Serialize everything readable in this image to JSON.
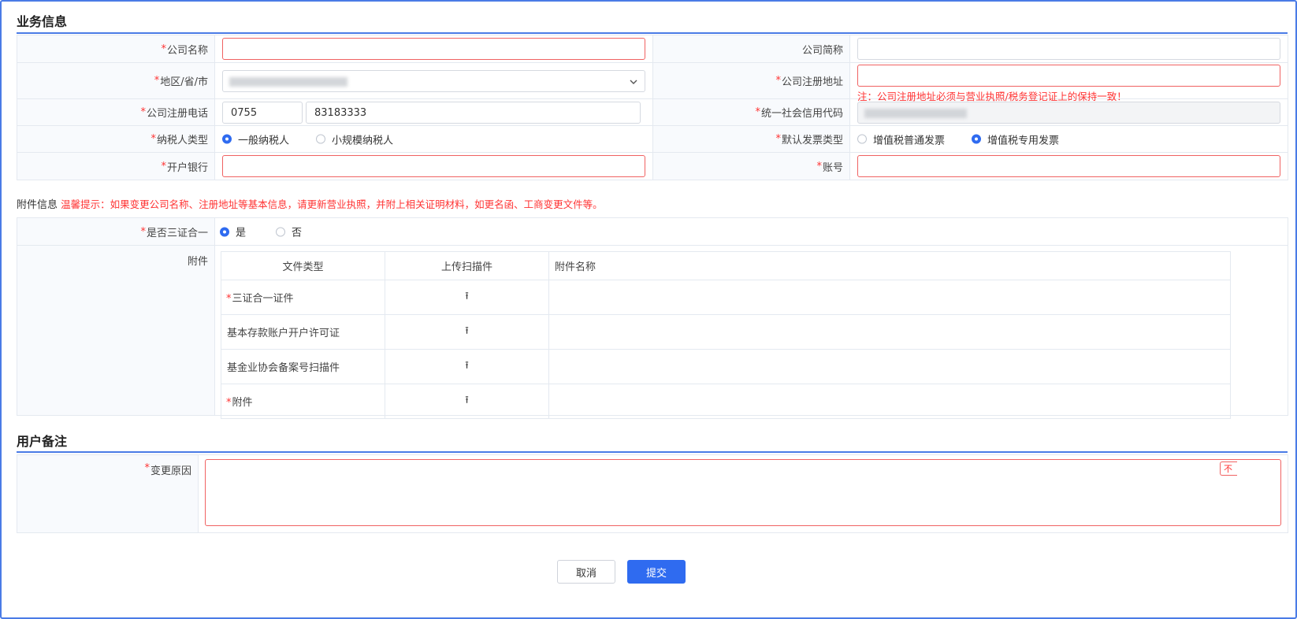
{
  "business": {
    "title": "业务信息",
    "company_name_label": "公司名称",
    "company_short_label": "公司简称",
    "region_label": "地区/省/市",
    "reg_address_label": "公司注册地址",
    "reg_address_note": "注：公司注册地址必须与营业执照/税务登记证上的保持一致！",
    "reg_phone_label": "公司注册电话",
    "phone_area": "0755",
    "phone_number": "83183333",
    "credit_code_label": "统一社会信用代码",
    "taxpayer_label": "纳税人类型",
    "taxpayer_options": [
      "一般纳税人",
      "小规模纳税人"
    ],
    "invoice_label": "默认发票类型",
    "invoice_options": [
      "增值税普通发票",
      "增值税专用发票"
    ],
    "bank_label": "开户银行",
    "account_label": "账号"
  },
  "attachment": {
    "section_label": "附件信息",
    "tip": "温馨提示：如果变更公司名称、注册地址等基本信息，请更新营业执照，并附上相关证明材料，如更名函、工商变更文件等。",
    "three_in_one_label": "是否三证合一",
    "yes": "是",
    "no": "否",
    "attach_label": "附件",
    "columns": [
      "文件类型",
      "上传扫描件",
      "附件名称"
    ],
    "rows": [
      {
        "name": "三证合一证件",
        "required": "*"
      },
      {
        "name": "基本存款账户开户许可证",
        "required": ""
      },
      {
        "name": "基金业协会备案号扫描件",
        "required": ""
      },
      {
        "name": "附件",
        "required": "*"
      }
    ]
  },
  "remark": {
    "title": "用户备注",
    "reason_label": "变更原因",
    "tip_tag": "不"
  },
  "buttons": {
    "cancel": "取消",
    "submit": "提交"
  },
  "colors": {
    "accent": "#2f6bf0",
    "error": "#f33333",
    "border": "#e4e9f0"
  }
}
